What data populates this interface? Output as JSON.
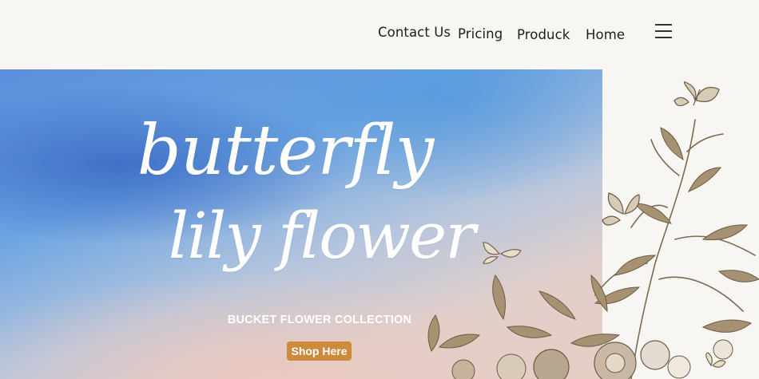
{
  "nav": {
    "items": [
      {
        "label": "Contact Us"
      },
      {
        "label": "Pricing"
      },
      {
        "label": "Produck"
      },
      {
        "label": "Home"
      }
    ],
    "menu_icon": "hamburger-menu-icon"
  },
  "hero": {
    "title_line1": "butterfly",
    "title_line2": "lily flower",
    "subtitle": "BUCKET FLOWER  COLLECTION",
    "cta_label": "Shop Here"
  },
  "colors": {
    "cta": "#cc8a3c",
    "nav_text": "#1e1e1e",
    "illustration": "#8a7558"
  }
}
